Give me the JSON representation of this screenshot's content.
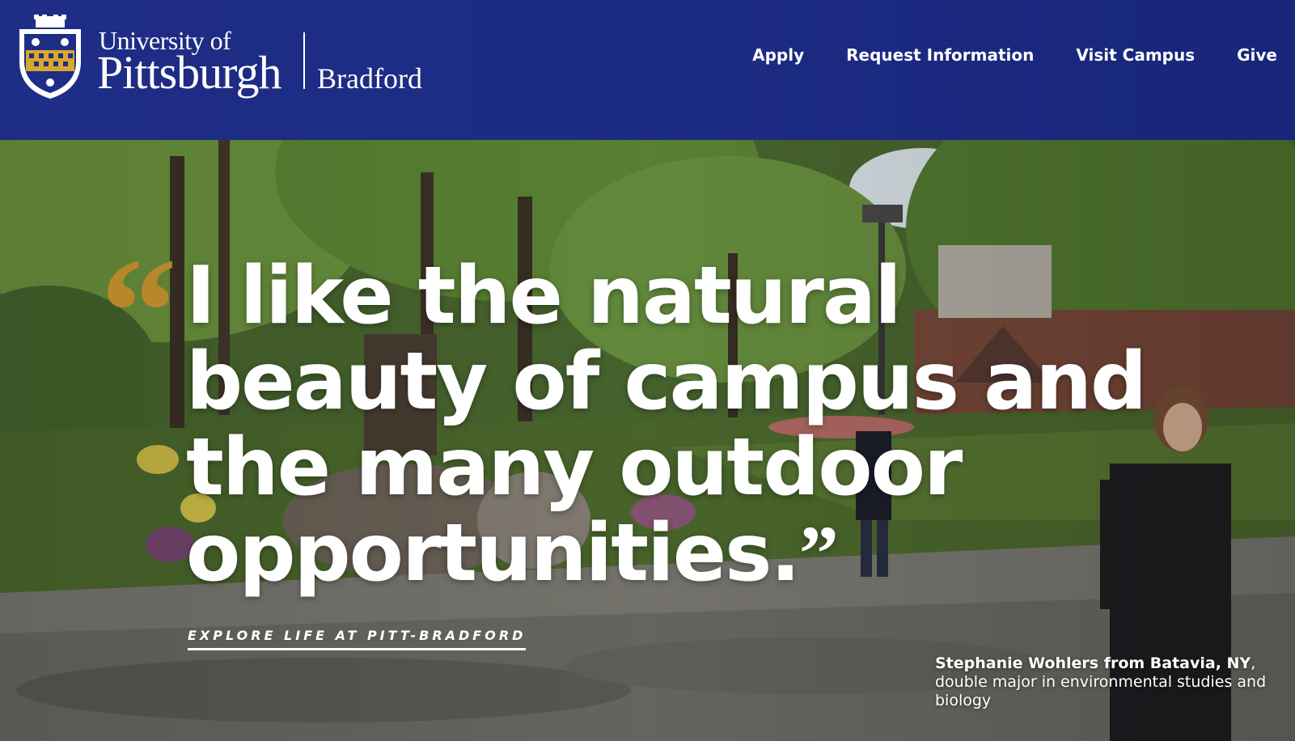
{
  "header": {
    "logo": {
      "line1": "University of",
      "line2": "Pittsburgh",
      "campus": "Bradford"
    },
    "nav": [
      {
        "label": "Apply"
      },
      {
        "label": "Request Information"
      },
      {
        "label": "Visit Campus"
      },
      {
        "label": "Give"
      }
    ],
    "colors": {
      "background": "#1e2d86",
      "text": "#ffffff"
    }
  },
  "hero": {
    "quote_open": "“",
    "quote_lines": [
      "I like the natural",
      "beauty of campus and",
      "the many outdoor",
      "opportunities."
    ],
    "quote_close": "”",
    "cta": "EXPLORE LIFE AT PITT-BRADFORD",
    "caption_bold": "Stephanie Wohlers from Batavia, NY",
    "caption_rest": ", double major in environmental studies and biology",
    "colors": {
      "quote_mark": "#b8872a",
      "text": "#ffffff"
    }
  }
}
